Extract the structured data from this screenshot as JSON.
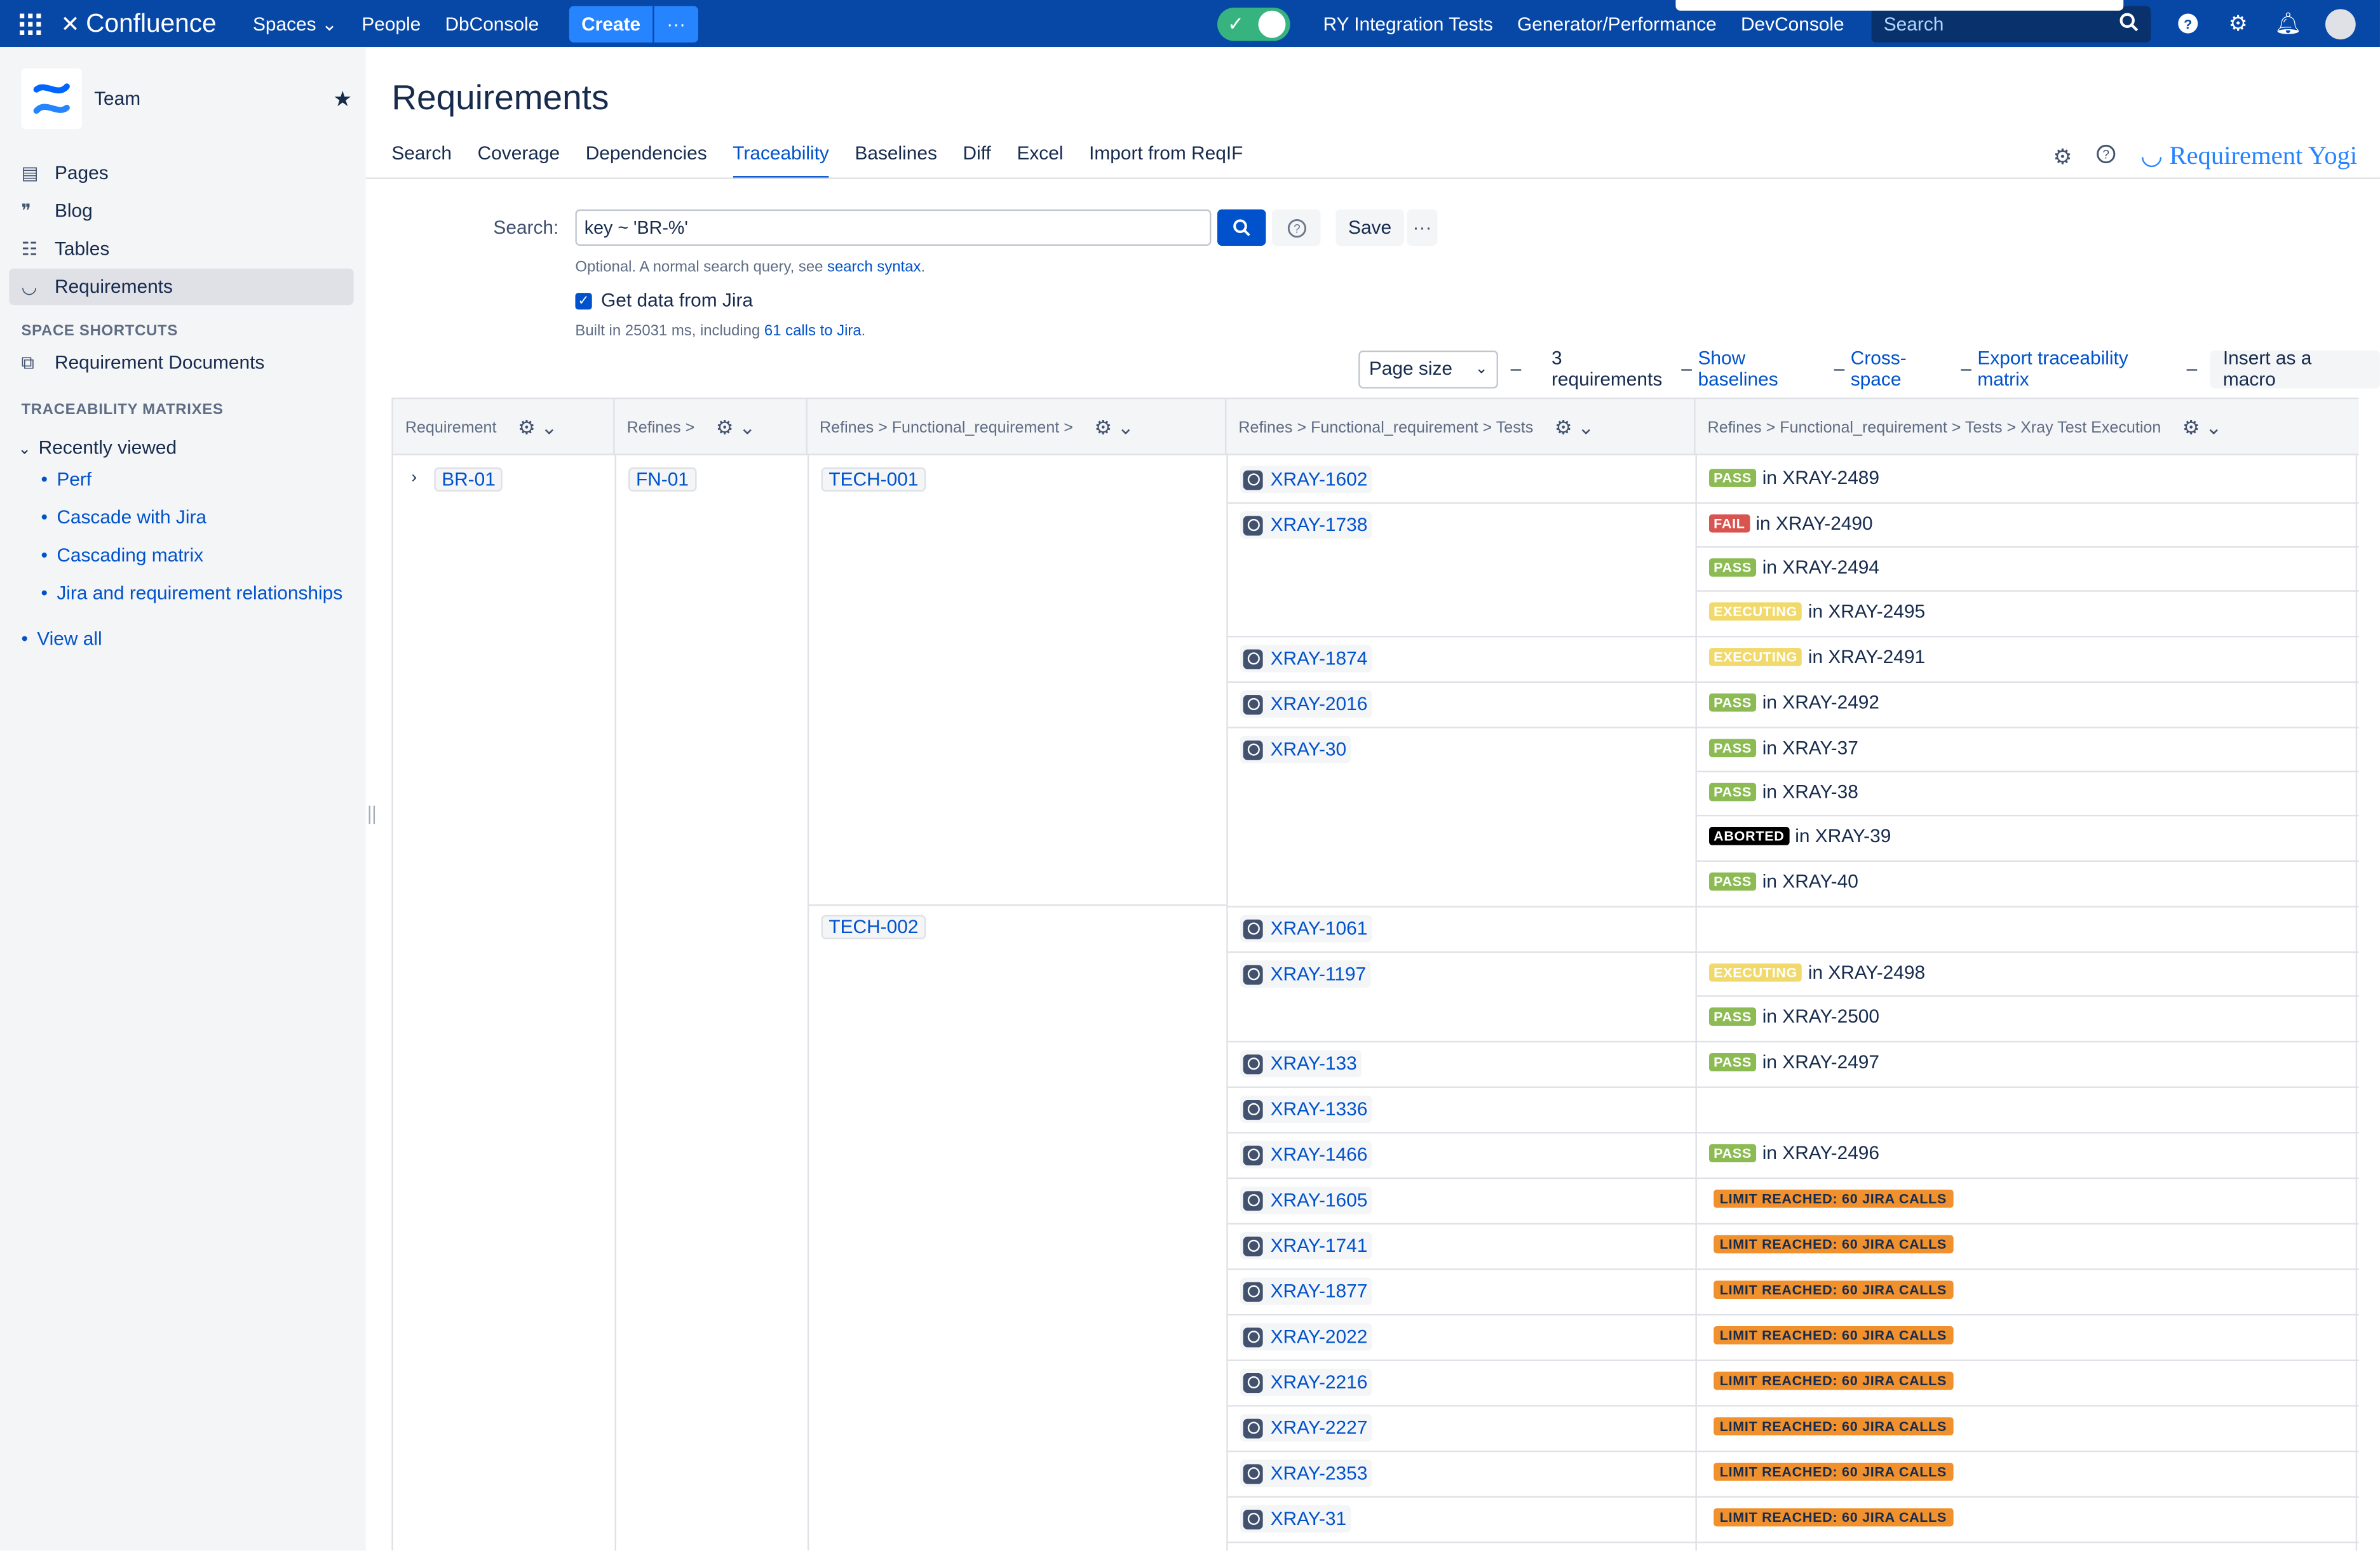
{
  "topbar": {
    "brand": "Confluence",
    "nav": [
      "Spaces",
      "People",
      "DbConsole"
    ],
    "create_label": "Create",
    "links": [
      "RY Integration Tests",
      "Generator/Performance",
      "DevConsole"
    ],
    "search_placeholder": "Search"
  },
  "sidebar": {
    "space_name": "Team",
    "items": [
      "Pages",
      "Blog",
      "Tables",
      "Requirements"
    ],
    "shortcuts_heading": "SPACE SHORTCUTS",
    "shortcut": "Requirement Documents",
    "matrix_heading": "TRACEABILITY MATRIXES",
    "recently_viewed": "Recently viewed",
    "recent_items": [
      "Perf",
      "Cascade with Jira",
      "Cascading matrix",
      "Jira and requirement relationships"
    ],
    "view_all": "View all"
  },
  "page": {
    "title": "Requirements",
    "tabs": [
      "Search",
      "Coverage",
      "Dependencies",
      "Traceability",
      "Baselines",
      "Diff",
      "Excel",
      "Import from ReqIF"
    ],
    "active_tab": "Traceability",
    "brand": "Requirement Yogi"
  },
  "search": {
    "label": "Search:",
    "value": "key ~ 'BR-%'",
    "save_label": "Save",
    "hint_prefix": "Optional. A normal search query, see ",
    "hint_link": "search syntax",
    "hint_suffix": ".",
    "checkbox_label": "Get data from Jira",
    "built_prefix": "Built in 25031 ms, including ",
    "built_link": "61 calls to Jira",
    "built_suffix": "."
  },
  "info": {
    "page_size": "Page size",
    "count": "3 requirements",
    "show_baselines": "Show baselines",
    "cross_space": "Cross-space",
    "export": "Export traceability matrix",
    "insert_macro": "Insert as a macro"
  },
  "table": {
    "headers": [
      "Requirement",
      "Refines >",
      "Refines > Functional_requirement >",
      "Refines > Functional_requirement > Tests",
      "Refines > Functional_requirement > Tests > Xray Test Execution"
    ],
    "requirement": "BR-01",
    "refines": "FN-01",
    "functional": [
      "TECH-001",
      "TECH-002"
    ],
    "tests": [
      "XRAY-1602",
      "XRAY-1738",
      "XRAY-1874",
      "XRAY-2016",
      "XRAY-30",
      "XRAY-1061",
      "XRAY-1197",
      "XRAY-133",
      "XRAY-1336",
      "XRAY-1466",
      "XRAY-1605",
      "XRAY-1741",
      "XRAY-1877",
      "XRAY-2022",
      "XRAY-2216",
      "XRAY-2227",
      "XRAY-2353",
      "XRAY-31"
    ],
    "executions": [
      {
        "status": "PASS",
        "in": "in XRAY-2489"
      },
      {
        "status": "FAIL",
        "in": "in XRAY-2490"
      },
      {
        "status": "PASS",
        "in": "in XRAY-2494"
      },
      {
        "status": "EXECUTING",
        "in": "in XRAY-2495"
      },
      {
        "status": "EXECUTING",
        "in": "in XRAY-2491"
      },
      {
        "status": "PASS",
        "in": "in XRAY-2492"
      },
      {
        "status": "PASS",
        "in": "in XRAY-37"
      },
      {
        "status": "PASS",
        "in": "in XRAY-38"
      },
      {
        "status": "ABORTED",
        "in": "in XRAY-39"
      },
      {
        "status": "PASS",
        "in": "in XRAY-40"
      },
      {
        "status": "EXECUTING",
        "in": "in XRAY-2498"
      },
      {
        "status": "PASS",
        "in": "in XRAY-2500"
      },
      {
        "status": "PASS",
        "in": "in XRAY-2497"
      },
      {
        "status": "PASS",
        "in": "in XRAY-2496"
      }
    ],
    "limit_label": "LIMIT REACHED: 60 JIRA CALLS"
  }
}
